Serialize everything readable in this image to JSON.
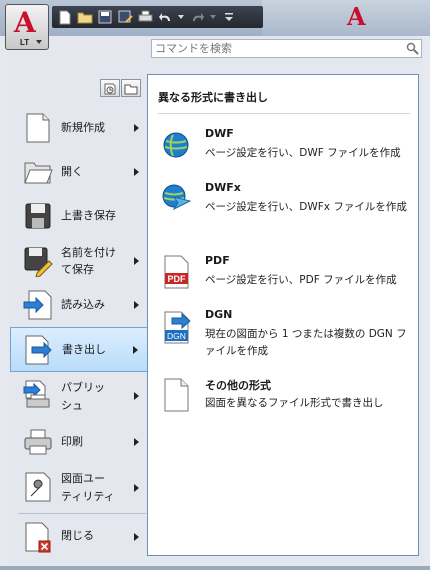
{
  "app": {
    "menu_button_sublabel": "LT"
  },
  "search": {
    "placeholder": "コマンドを検索"
  },
  "left_menu": {
    "items": [
      {
        "label_lines": [
          "新規作成"
        ],
        "has_submenu": true
      },
      {
        "label_lines": [
          "開く"
        ],
        "has_submenu": true
      },
      {
        "label_lines": [
          "上書き保存"
        ],
        "has_submenu": false
      },
      {
        "label_lines": [
          "名前を付け",
          "て保存"
        ],
        "has_submenu": true
      },
      {
        "label_lines": [
          "読み込み"
        ],
        "has_submenu": true
      },
      {
        "label_lines": [
          "書き出し"
        ],
        "has_submenu": true,
        "active": true
      },
      {
        "label_lines": [
          "パブリッ",
          "シュ"
        ],
        "has_submenu": true
      },
      {
        "label_lines": [
          "印刷"
        ],
        "has_submenu": true
      },
      {
        "label_lines": [
          "図面ユー",
          "ティリティ"
        ],
        "has_submenu": true
      },
      {
        "label_lines": [
          "閉じる"
        ],
        "has_submenu": true
      }
    ]
  },
  "export_panel": {
    "title": "異なる形式に書き出し",
    "items": [
      {
        "name": "DWF",
        "desc": "ページ設定を行い、DWF ファイルを作成",
        "icon": "dwf-globe-icon"
      },
      {
        "name": "DWFx",
        "desc": "ページ設定を行い、DWFx ファイルを作成",
        "icon": "dwfx-globe-icon"
      },
      {
        "name": "PDF",
        "desc": "ページ設定を行い、PDF ファイルを作成",
        "icon": "pdf-file-icon"
      },
      {
        "name": "DGN",
        "desc": "現在の図面から 1 つまたは複数の DGN ファイルを作成",
        "icon": "dgn-file-icon"
      },
      {
        "name": "その他の形式",
        "desc": "図面を異なるファイル形式で書き出し",
        "icon": "blank-file-icon"
      }
    ]
  },
  "colors": {
    "accent": "#c8102e",
    "active_bg": "#b9dcf9",
    "panel_border": "#6d8fb8"
  }
}
